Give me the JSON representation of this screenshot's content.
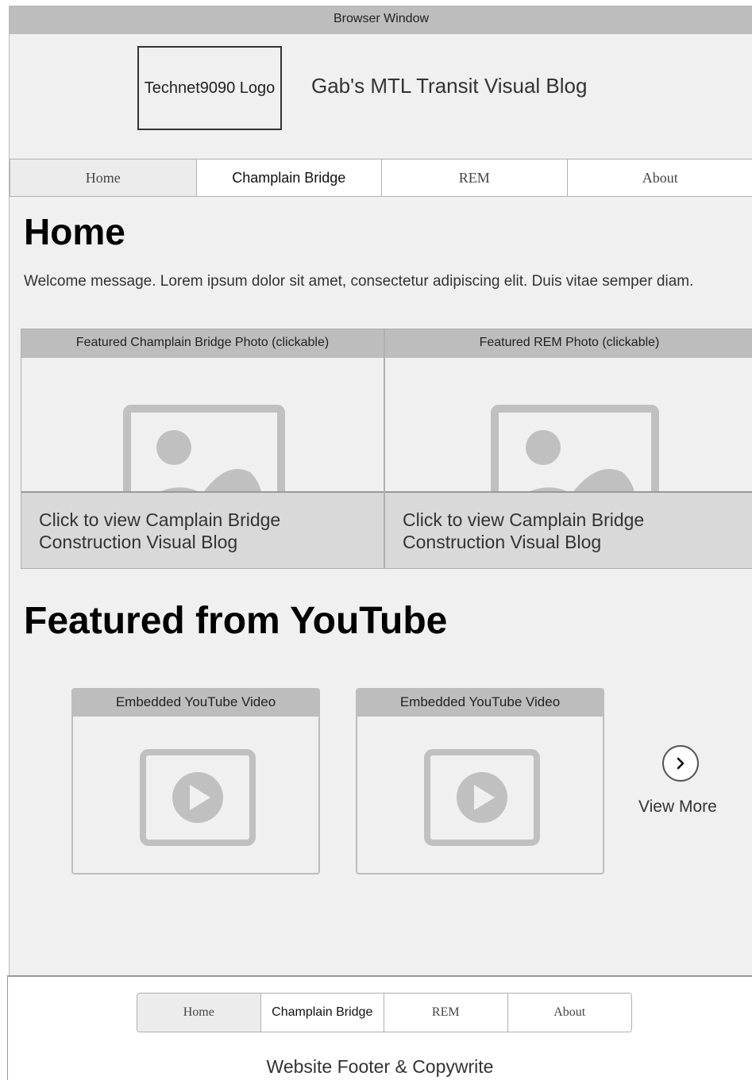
{
  "window": {
    "title": "Browser Window"
  },
  "header": {
    "logo_text": "Technet9090 Logo",
    "site_title": "Gab's MTL Transit Visual Blog"
  },
  "nav": {
    "items": [
      {
        "label": "Home",
        "active": true
      },
      {
        "label": "Champlain Bridge",
        "active": false
      },
      {
        "label": "REM",
        "active": false
      },
      {
        "label": "About",
        "active": false
      }
    ]
  },
  "main": {
    "page_title": "Home",
    "welcome": "Welcome message. Lorem ipsum dolor sit amet, consectetur adipiscing elit. Duis vitae semper diam.",
    "featured_photos": [
      {
        "title": "Featured Champlain Bridge Photo (clickable)",
        "caption": "Click to view Camplain Bridge Construction Visual Blog",
        "icon": "image-placeholder-icon"
      },
      {
        "title": "Featured REM Photo (clickable)",
        "caption": "Click to view Camplain Bridge Construction Visual Blog",
        "icon": "image-placeholder-icon"
      }
    ],
    "youtube_section_title": "Featured from YouTube",
    "videos": [
      {
        "title": "Embedded YouTube Video",
        "icon": "play-video-icon"
      },
      {
        "title": "Embedded YouTube Video",
        "icon": "play-video-icon"
      }
    ],
    "view_more": {
      "label": "View More",
      "icon": "chevron-right-icon"
    }
  },
  "footer": {
    "nav": [
      {
        "label": "Home",
        "active": true
      },
      {
        "label": "Champlain Bridge",
        "active": false
      },
      {
        "label": "REM",
        "active": false
      },
      {
        "label": "About",
        "active": false
      }
    ],
    "text": "Website Footer & Copywrite"
  },
  "colors": {
    "page_bg": "#f0f0f0",
    "header_bar": "#bdbdbd",
    "icon_gray": "#c0c0c0",
    "caption_bg": "#d9d9d9"
  }
}
